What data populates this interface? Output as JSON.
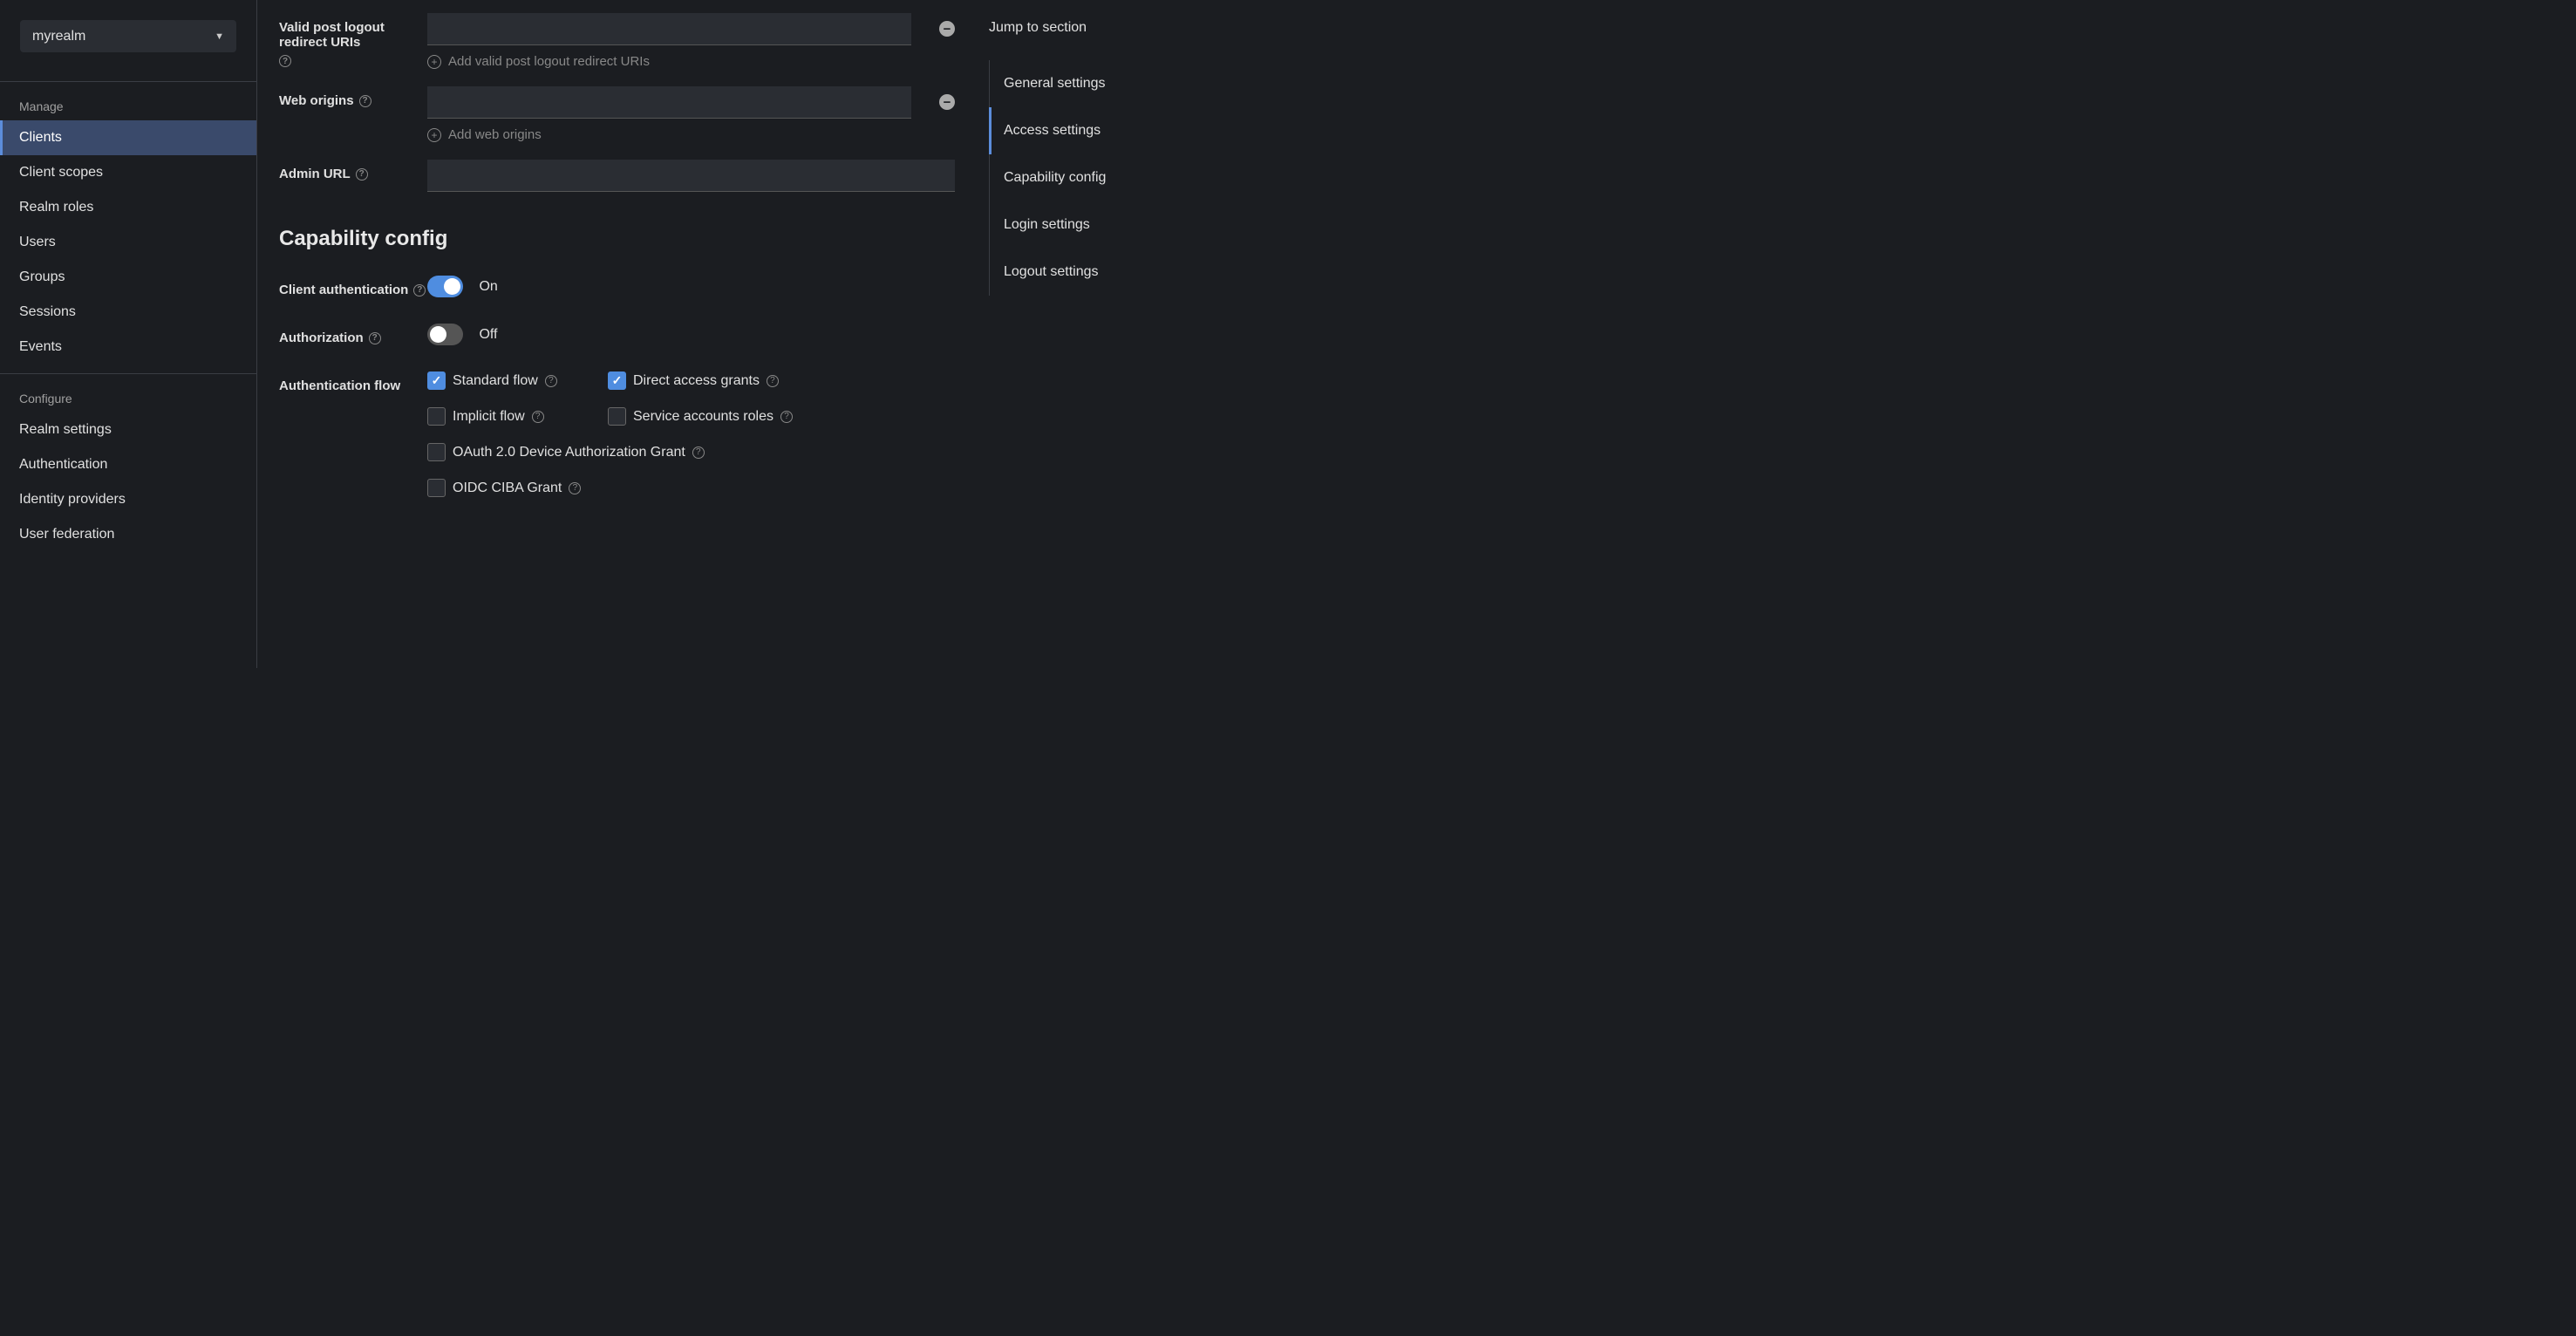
{
  "realm": {
    "selected": "myrealm"
  },
  "sidebar": {
    "manage_header": "Manage",
    "configure_header": "Configure",
    "manage_items": [
      {
        "label": "Clients",
        "active": true
      },
      {
        "label": "Client scopes"
      },
      {
        "label": "Realm roles"
      },
      {
        "label": "Users"
      },
      {
        "label": "Groups"
      },
      {
        "label": "Sessions"
      },
      {
        "label": "Events"
      }
    ],
    "configure_items": [
      {
        "label": "Realm settings"
      },
      {
        "label": "Authentication"
      },
      {
        "label": "Identity providers"
      },
      {
        "label": "User federation"
      }
    ]
  },
  "access": {
    "valid_post_logout_label": "Valid post logout redirect URIs",
    "add_valid_post_logout": "Add valid post logout redirect URIs",
    "web_origins_label": "Web origins",
    "add_web_origins": "Add web origins",
    "admin_url_label": "Admin URL",
    "valid_post_logout_value": "",
    "web_origins_value": "",
    "admin_url_value": ""
  },
  "capability": {
    "heading": "Capability config",
    "client_auth_label": "Client authentication",
    "client_auth_state": "On",
    "authorization_label": "Authorization",
    "authorization_state": "Off",
    "auth_flow_label": "Authentication flow",
    "flows": {
      "standard": {
        "label": "Standard flow",
        "checked": true
      },
      "direct": {
        "label": "Direct access grants",
        "checked": true
      },
      "implicit": {
        "label": "Implicit flow",
        "checked": false
      },
      "service": {
        "label": "Service accounts roles",
        "checked": false
      },
      "oauth": {
        "label": "OAuth 2.0 Device Authorization Grant",
        "checked": false
      },
      "oidc": {
        "label": "OIDC CIBA Grant",
        "checked": false
      }
    }
  },
  "jump": {
    "heading": "Jump to section",
    "items": [
      {
        "label": "General settings"
      },
      {
        "label": "Access settings",
        "active": true
      },
      {
        "label": "Capability config"
      },
      {
        "label": "Login settings"
      },
      {
        "label": "Logout settings"
      }
    ]
  }
}
